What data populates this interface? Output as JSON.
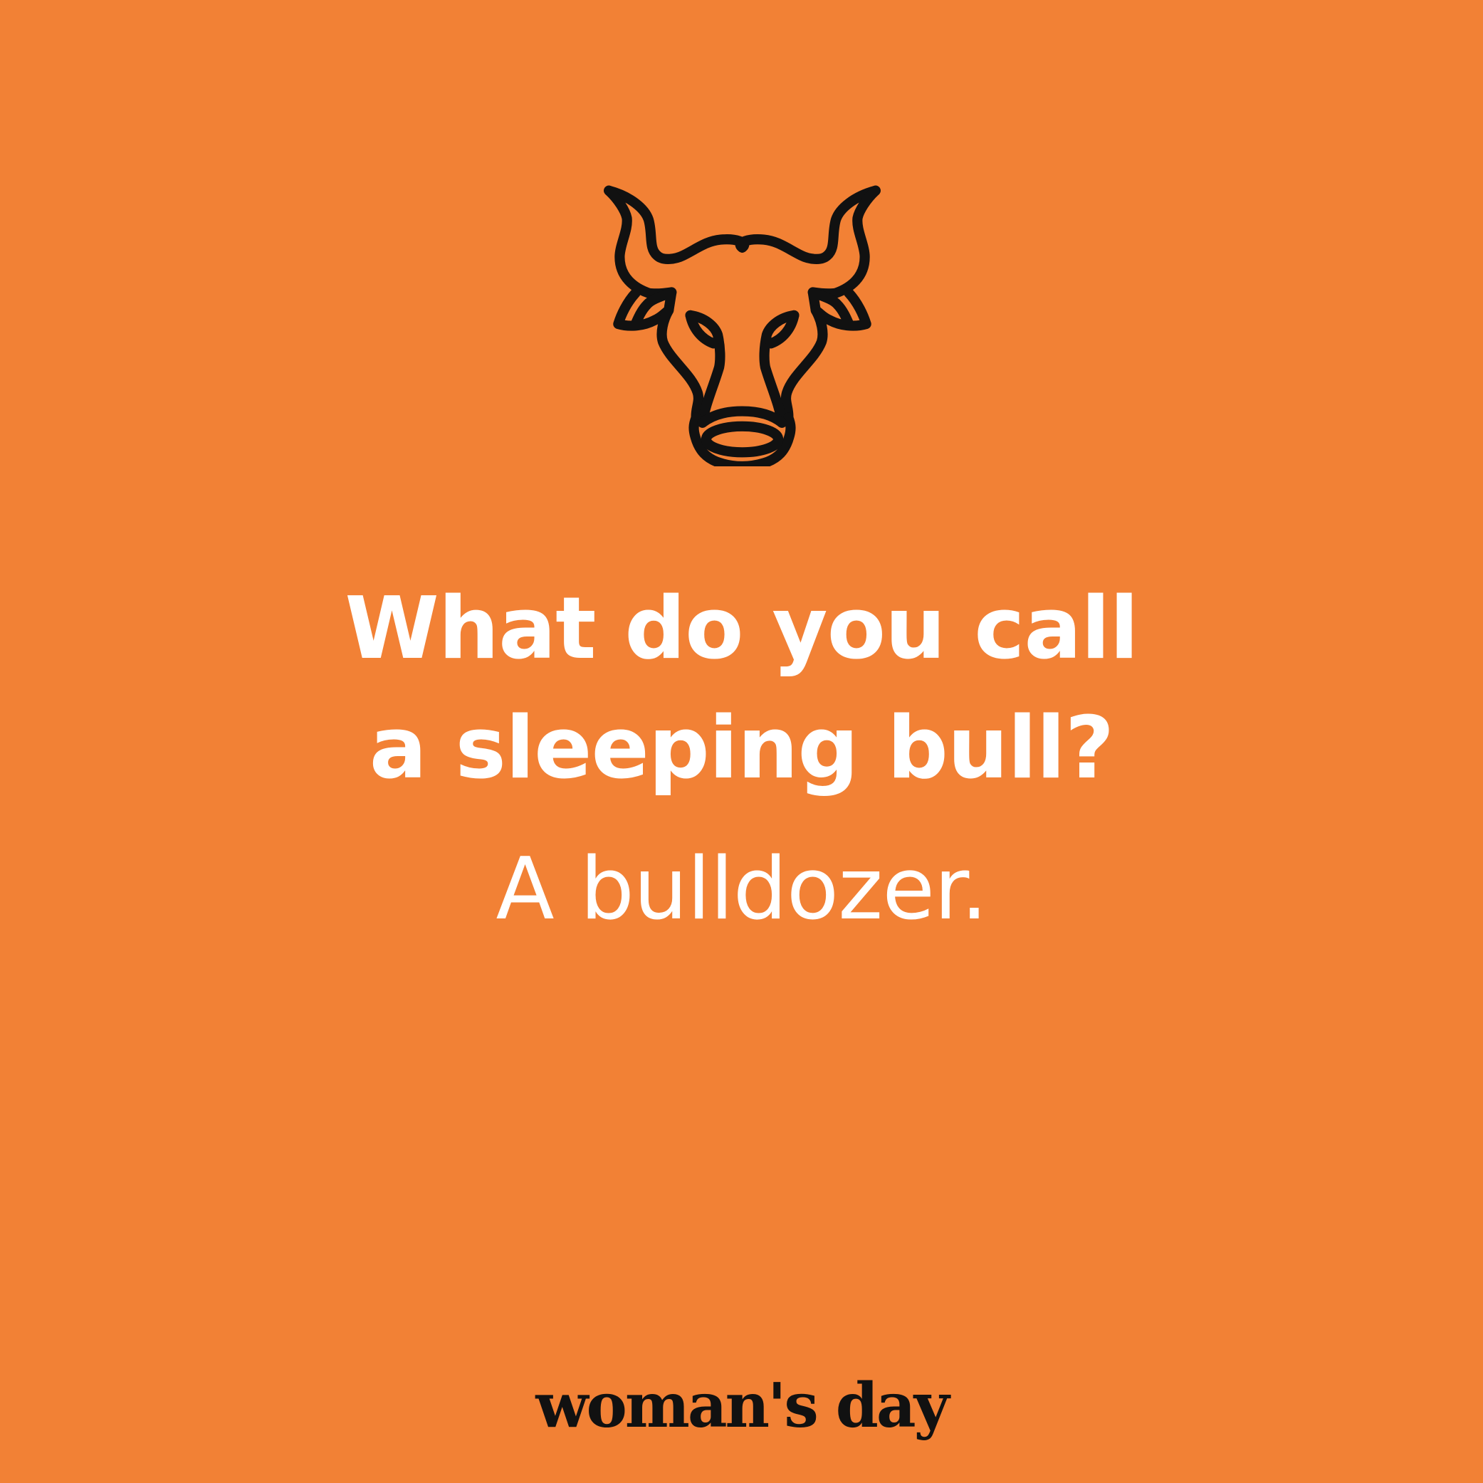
{
  "background_color": "#F28135",
  "text_color": "#FFFFFF",
  "icon": {
    "name": "bull-head-icon",
    "stroke_color": "#111111"
  },
  "joke": {
    "question_line_1": "What do you call",
    "question_line_2": "a sleeping bull?",
    "answer": "A bulldozer."
  },
  "brand": {
    "logo_text": "woman's day",
    "logo_color": "#111111"
  }
}
